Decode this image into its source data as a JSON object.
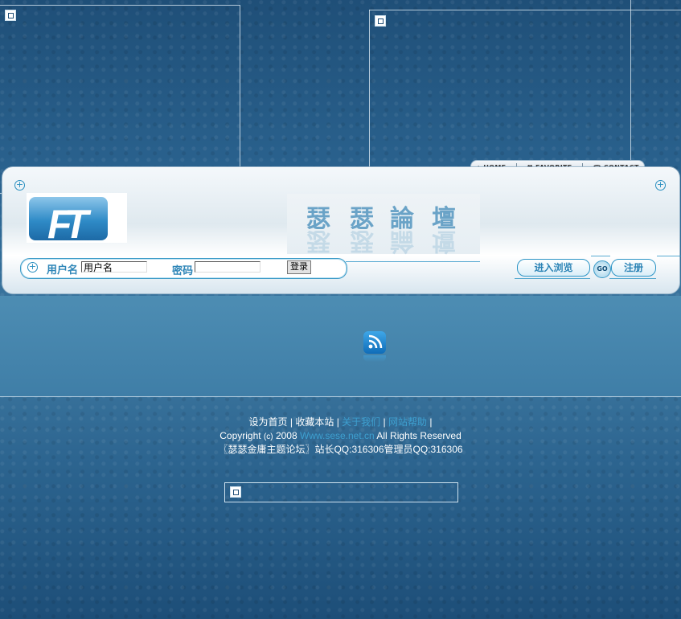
{
  "header": {
    "nav": [
      {
        "label": "HOME",
        "icon": "home-icon"
      },
      {
        "label": "FAVORITE",
        "icon": "heart-icon"
      },
      {
        "label": "CONTACT",
        "icon": "phone-icon"
      }
    ],
    "site_title_chars": [
      "瑟",
      "瑟",
      "論",
      "壇"
    ]
  },
  "login": {
    "username_label": "用户名",
    "username_value": "用户名",
    "password_label": "密码",
    "password_value": "",
    "login_button": "登录",
    "enter_button": "进入浏览",
    "go_button": "GO",
    "register_button": "注册"
  },
  "footer": {
    "links": [
      "设为首页",
      "收藏本站",
      "关于我们",
      "网站帮助"
    ],
    "separator": "|",
    "copyright_prefix": "Copyright",
    "copyright_symbol": "(c)",
    "year": "2008",
    "domain": "Www.sese.net.cn",
    "rights": "All Rights Reserved",
    "contact": "〖瑟瑟金庸主题论坛〗站长QQ:316306管理员QQ:316306"
  },
  "colors": {
    "accent": "#2f86b8",
    "link": "#3ea0d0",
    "background": "#2d6794"
  }
}
